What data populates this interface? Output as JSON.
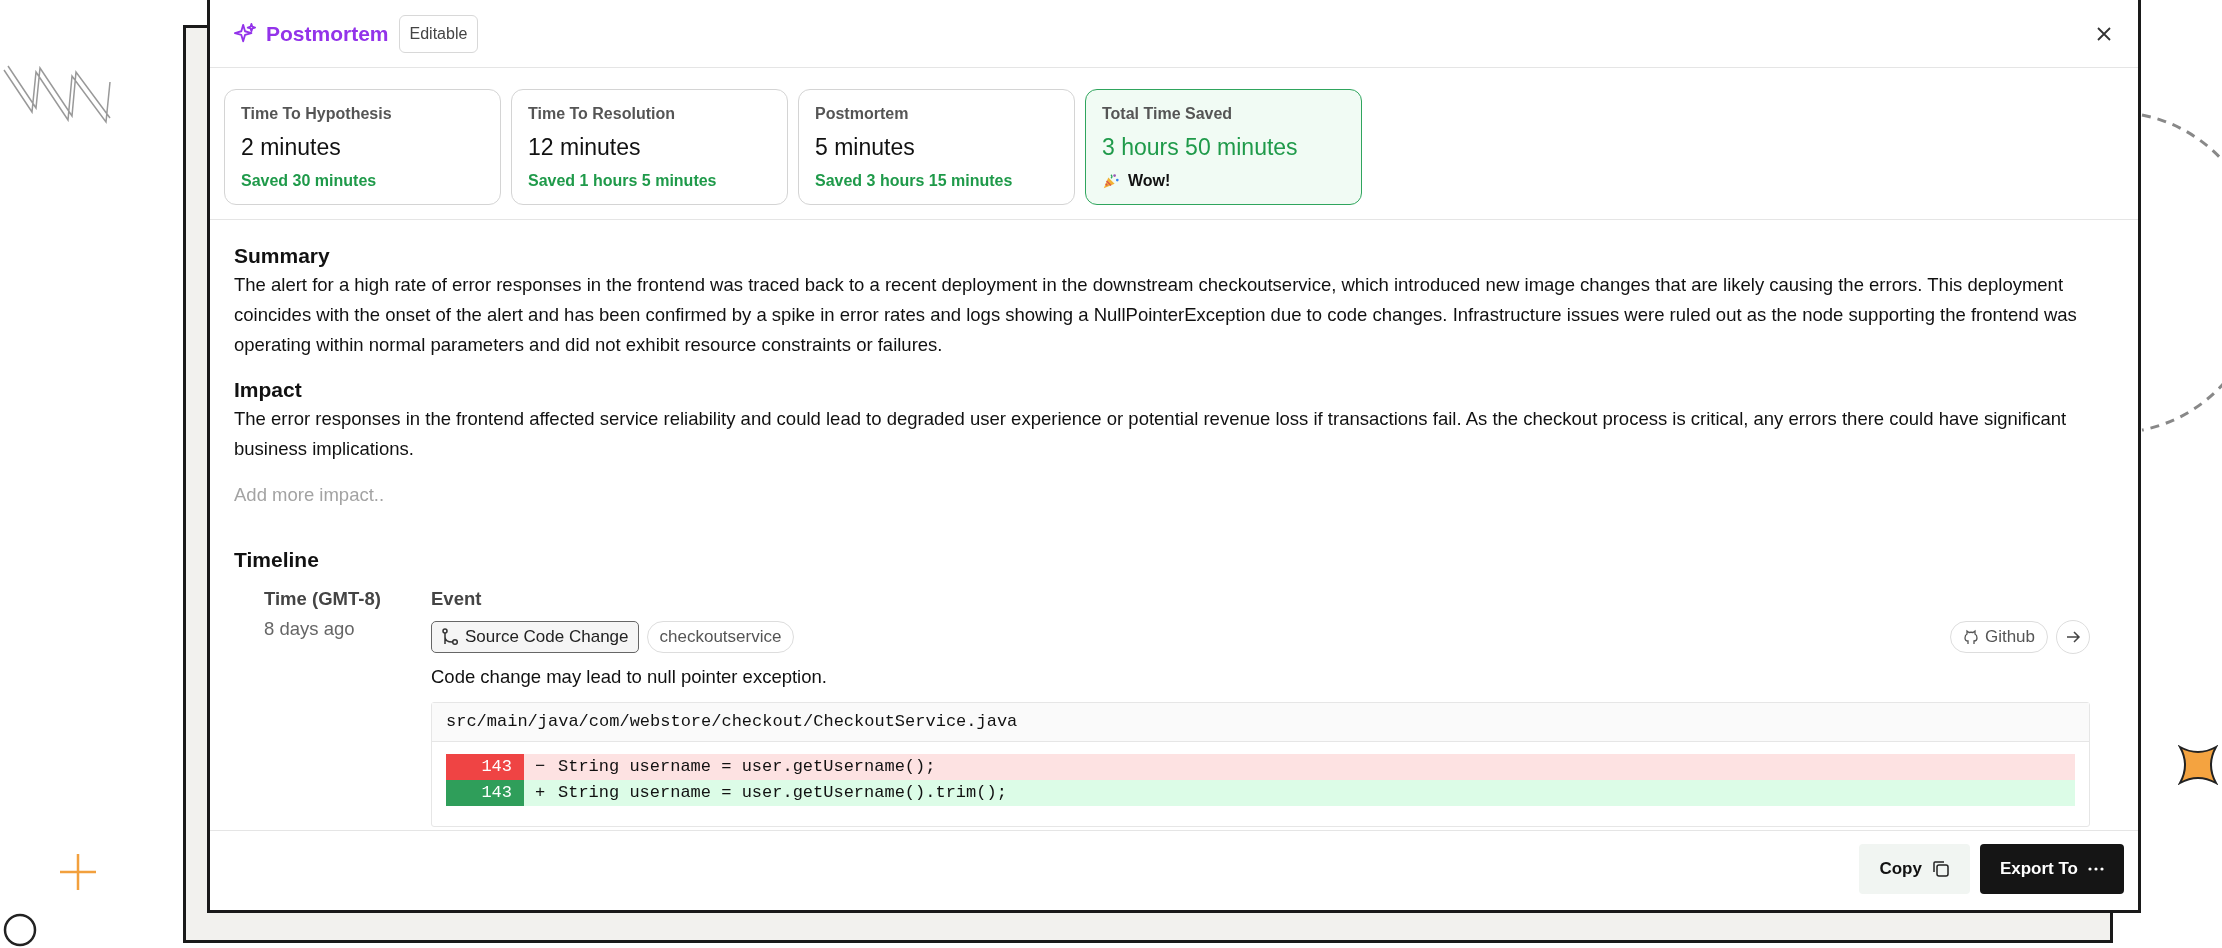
{
  "header": {
    "title": "Postmortem",
    "badge": "Editable"
  },
  "stats": [
    {
      "label": "Time To Hypothesis",
      "value": "2 minutes",
      "note": "Saved 30 minutes",
      "highlight": false
    },
    {
      "label": "Time To Resolution",
      "value": "12 minutes",
      "note": "Saved 1 hours 5 minutes",
      "highlight": false
    },
    {
      "label": "Postmortem",
      "value": "5 minutes",
      "note": "Saved 3 hours 15 minutes",
      "highlight": false
    },
    {
      "label": "Total Time Saved",
      "value": "3 hours 50 minutes",
      "note": "Wow!",
      "highlight": true
    }
  ],
  "summary": {
    "heading": "Summary",
    "text": "The alert for a high rate of error responses in the frontend was traced back to a recent deployment in the downstream checkoutservice, which introduced new image changes that are likely causing the errors. This deployment coincides with the onset of the alert and has been confirmed by a spike in error rates and logs showing a NullPointerException due to code changes. Infrastructure issues were ruled out as the node supporting the frontend was operating within normal parameters and did not exhibit resource constraints or failures."
  },
  "impact": {
    "heading": "Impact",
    "text": "The error responses in the frontend affected service reliability and could lead to degraded user experience or potential revenue loss if transactions fail. As the checkout process is critical, any errors there could have significant business implications.",
    "placeholder": "Add more impact.."
  },
  "timeline": {
    "heading": "Timeline",
    "columns": [
      "Time (GMT-8)",
      "Event"
    ],
    "events": [
      {
        "time": "8 days ago",
        "tags": [
          {
            "label": "Source Code Change",
            "kind": "type"
          },
          {
            "label": "checkoutservice",
            "kind": "service"
          }
        ],
        "source": "Github",
        "description": "Code change may lead to null pointer exception.",
        "file": "src/main/java/com/webstore/checkout/CheckoutService.java",
        "diff": [
          {
            "kind": "removed",
            "line": "143",
            "sign": "−",
            "code": "String username = user.getUsername();"
          },
          {
            "kind": "added",
            "line": "143",
            "sign": "+",
            "code": "String username = user.getUsername().trim();"
          }
        ]
      }
    ]
  },
  "footer": {
    "buttons": [
      {
        "label": "Copy",
        "kind": "copy"
      },
      {
        "label": "Export To",
        "kind": "export"
      }
    ]
  }
}
